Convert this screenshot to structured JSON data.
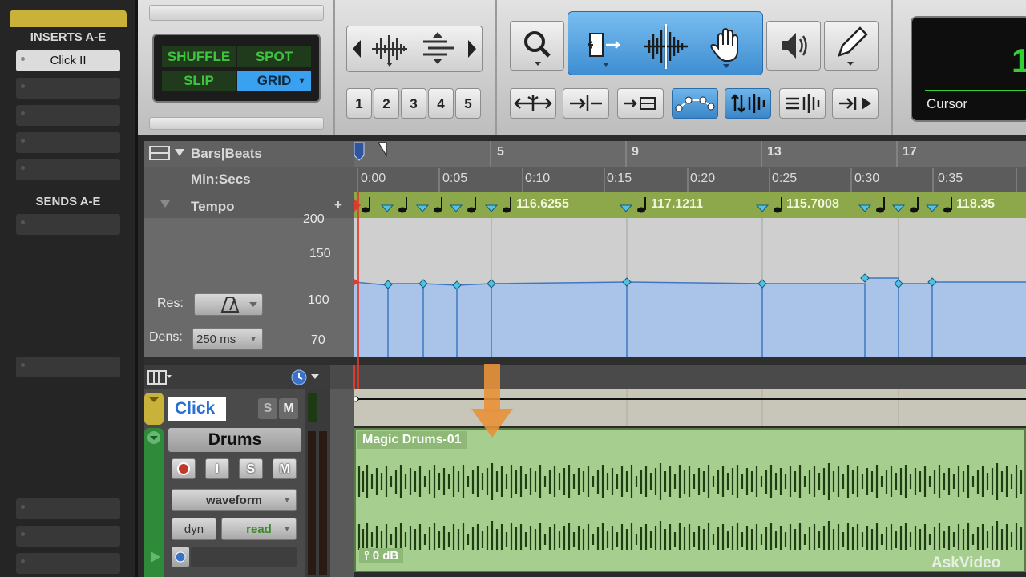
{
  "inserts": {
    "label": "INSERTS A-E",
    "first_insert": "Click II"
  },
  "sends": {
    "label": "SENDS A-E"
  },
  "modes": {
    "shuffle": "SHUFFLE",
    "spot": "SPOT",
    "slip": "SLIP",
    "grid": "GRID",
    "selected": "GRID"
  },
  "zoom_presets": [
    "1",
    "2",
    "3",
    "4",
    "5"
  ],
  "counter": {
    "main_value": "1",
    "cursor_label": "Cursor"
  },
  "rulers": {
    "bars_beats_label": "Bars|Beats",
    "min_secs_label": "Min:Secs",
    "tempo_label": "Tempo",
    "tempo_add": "+",
    "bars": [
      "5",
      "9",
      "13",
      "17"
    ],
    "min_secs": [
      "0:00",
      "0:05",
      "0:10",
      "0:15",
      "0:20",
      "0:25",
      "0:30",
      "0:35"
    ],
    "tempo_values": [
      "116.6255",
      "117.1211",
      "115.7008",
      "118.35"
    ]
  },
  "tempo_graph": {
    "y_ticks": [
      "200",
      "150",
      "100",
      "70"
    ],
    "res_label": "Res:",
    "dens_label": "Dens:",
    "dens_value": "250 ms",
    "line_color": "#3f78c0",
    "fill_color": "#a9c4e8"
  },
  "tracks": {
    "click": {
      "name": "Click",
      "solo": "S",
      "mute": "M"
    },
    "drums": {
      "name": "Drums",
      "record": "",
      "input": "I",
      "solo": "S",
      "mute": "M",
      "view": "waveform",
      "automation_label": "dyn",
      "automation_mode": "read",
      "region_name": "Magic Drums-01",
      "region_gain": "0 dB"
    }
  },
  "watermark": "AskVideo"
}
